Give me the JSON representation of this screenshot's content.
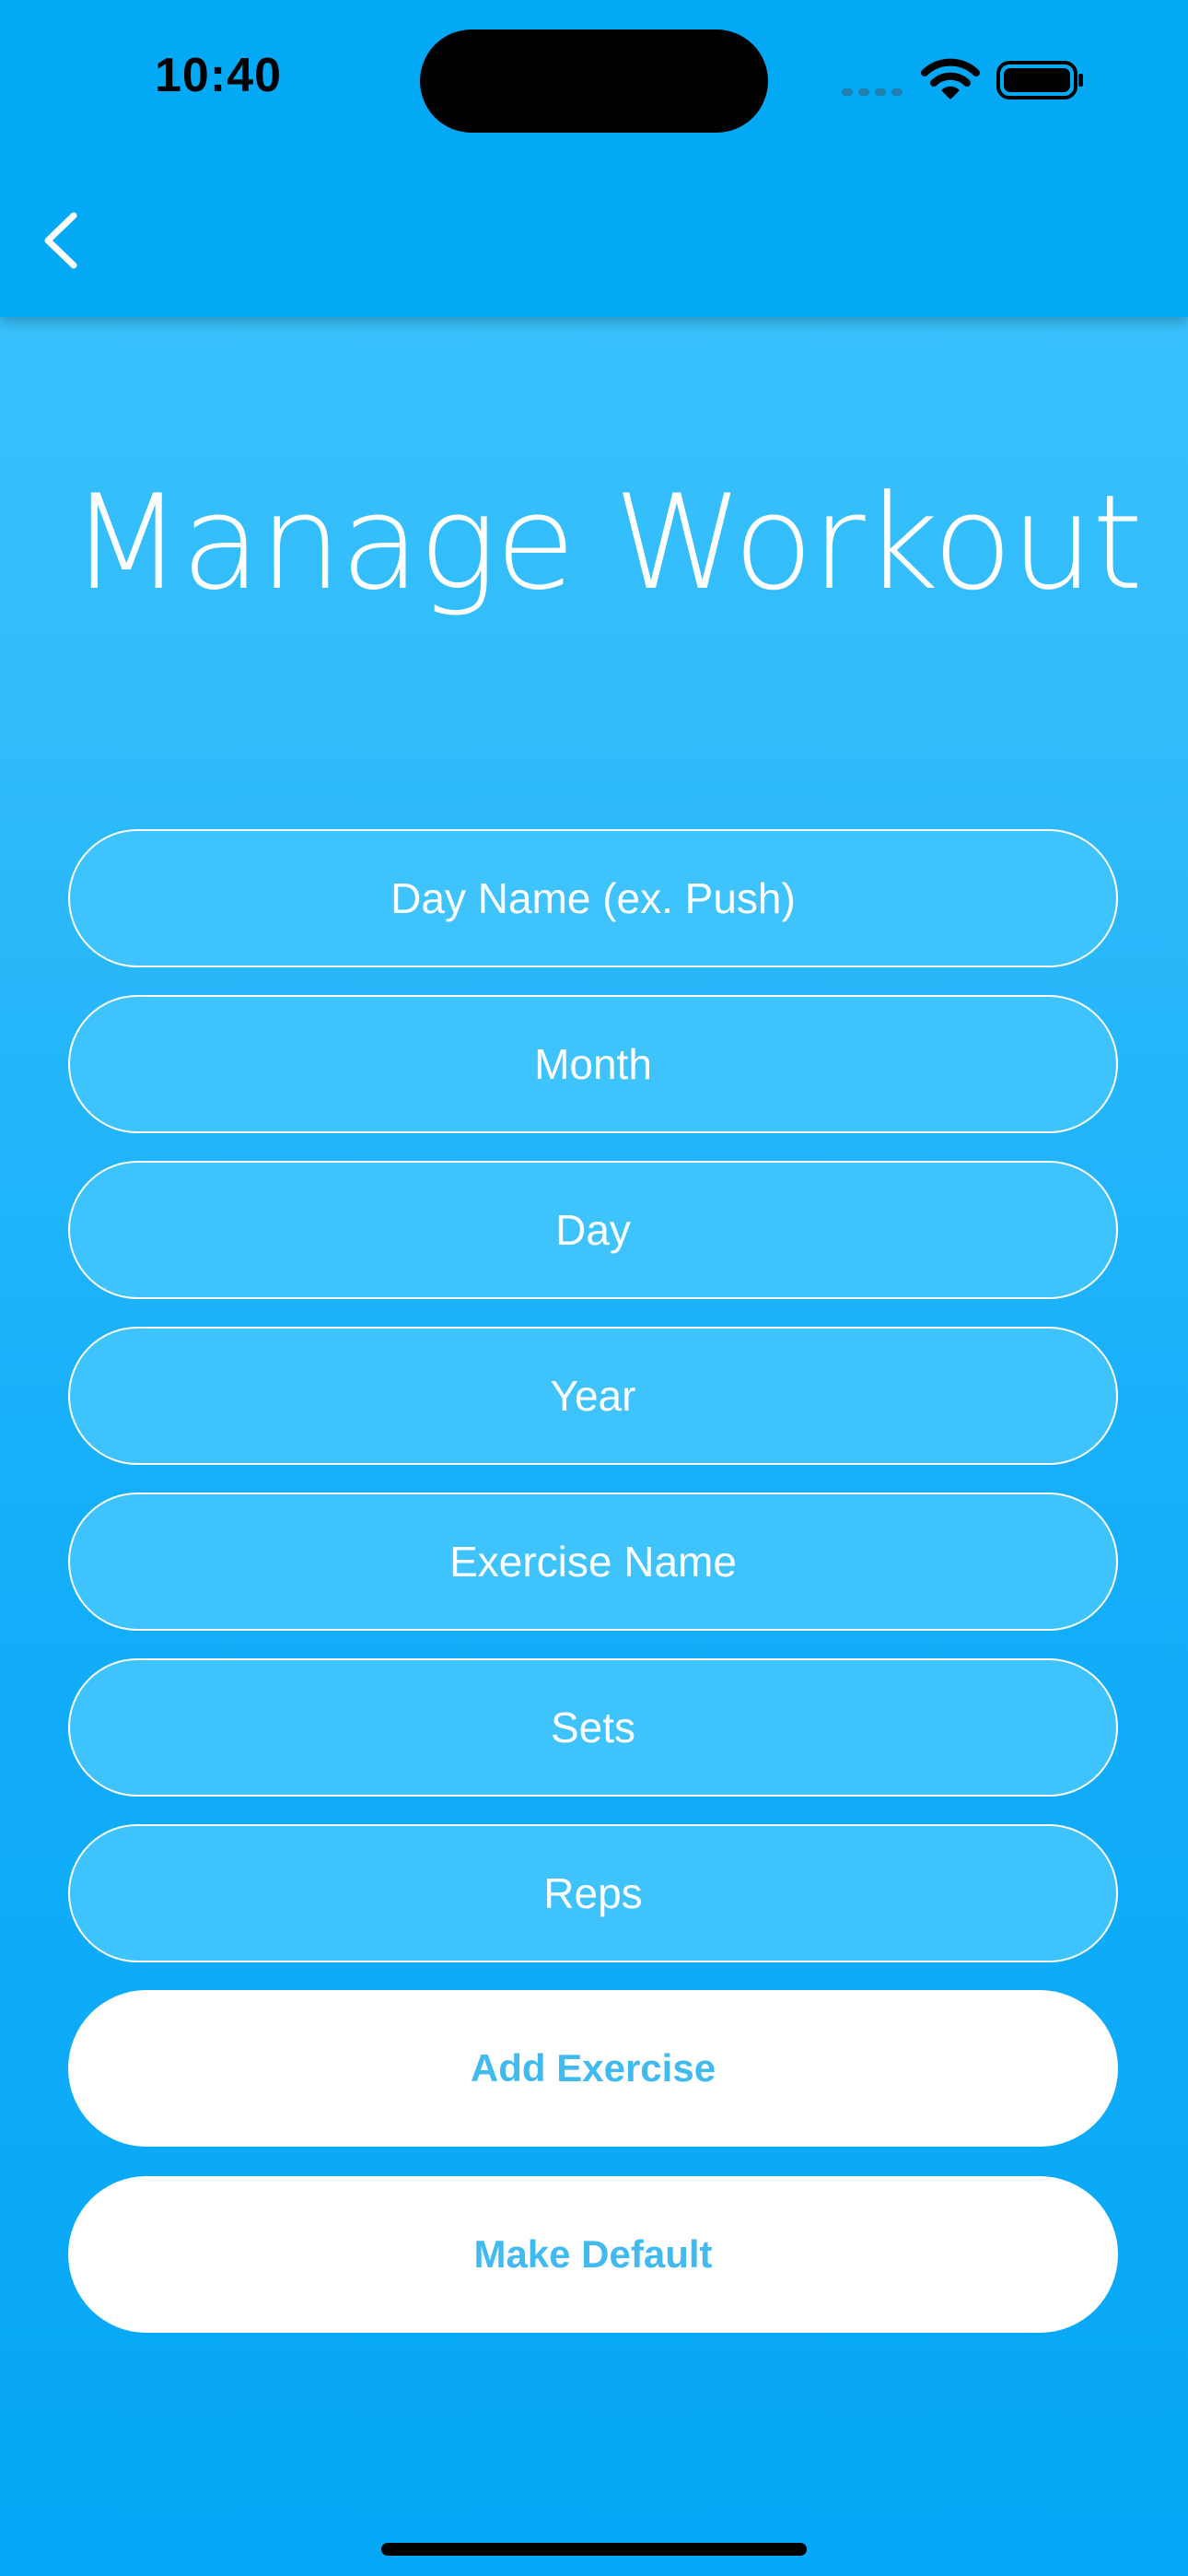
{
  "status_bar": {
    "time": "10:40",
    "icons": [
      "cellular-signal-icon",
      "wifi-icon",
      "battery-icon"
    ]
  },
  "nav": {
    "back_icon": "chevron-left-icon"
  },
  "page": {
    "title": "Manage Workout"
  },
  "form": {
    "fields": [
      {
        "name": "day-name",
        "placeholder": "Day Name (ex. Push)",
        "value": ""
      },
      {
        "name": "month",
        "placeholder": "Month",
        "value": ""
      },
      {
        "name": "day",
        "placeholder": "Day",
        "value": ""
      },
      {
        "name": "year",
        "placeholder": "Year",
        "value": ""
      },
      {
        "name": "exercise-name",
        "placeholder": "Exercise Name",
        "value": ""
      },
      {
        "name": "sets",
        "placeholder": "Sets",
        "value": ""
      },
      {
        "name": "reps",
        "placeholder": "Reps",
        "value": ""
      }
    ],
    "add_exercise_label": "Add Exercise",
    "make_default_label": "Make Default"
  },
  "colors": {
    "nav_background": "#03a9f4",
    "field_background": "#3fc3fc",
    "button_text": "#41baf0",
    "background_top": "#40c4fc",
    "background_bottom": "#05a7f6"
  }
}
